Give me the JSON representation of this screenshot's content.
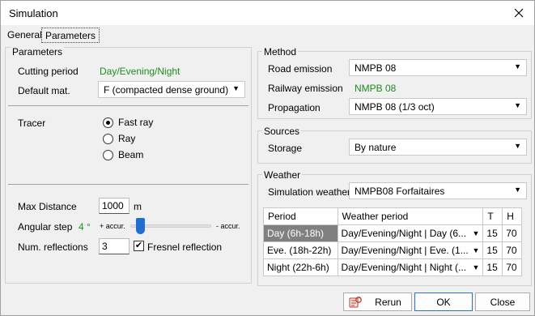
{
  "window": {
    "title": "Simulation"
  },
  "tabs": [
    "General",
    "Parameters"
  ],
  "parameters": {
    "group_title": "Parameters",
    "cutting_period_label": "Cutting period",
    "cutting_period_value": "Day/Evening/Night",
    "default_mat_label": "Default mat.",
    "default_mat_value": "F (compacted dense ground)",
    "tracer_label": "Tracer",
    "tracer_options": [
      "Fast ray",
      "Ray",
      "Beam"
    ],
    "tracer_selected": "Fast ray",
    "max_distance_label": "Max Distance",
    "max_distance_value": "1000",
    "max_distance_unit": "m",
    "angular_step_label": "Angular step",
    "angular_step_value": "4 °",
    "accur_more": "+ accur.",
    "accur_less": "- accur.",
    "angular_step_level": 0.12,
    "num_reflections_label": "Num. reflections",
    "num_reflections_value": "3",
    "fresnel_label": "Fresnel reflection",
    "fresnel_checked": true
  },
  "method": {
    "group_title": "Method",
    "road_label": "Road emission",
    "road_value": "NMPB 08",
    "rail_label": "Railway emission",
    "rail_value": "NMPB 08",
    "prop_label": "Propagation",
    "prop_value": "NMPB 08 (1/3 oct)"
  },
  "sources": {
    "group_title": "Sources",
    "storage_label": "Storage",
    "storage_value": "By nature"
  },
  "weather": {
    "group_title": "Weather",
    "sim_label": "Simulation weather",
    "sim_value": "NMPB08 Forfaitaires",
    "headers": [
      "Period",
      "Weather period",
      "T",
      "H"
    ],
    "rows": [
      {
        "period": "Day (6h-18h)",
        "weather": "Day/Evening/Night  |  Day (6...",
        "t": "15",
        "h": "70"
      },
      {
        "period": "Eve. (18h-22h)",
        "weather": "Day/Evening/Night  |  Eve. (1...",
        "t": "15",
        "h": "70"
      },
      {
        "period": "Night (22h-6h)",
        "weather": "Day/Evening/Night  |  Night (...",
        "t": "15",
        "h": "70"
      }
    ]
  },
  "buttons": {
    "rerun": "Rerun",
    "ok": "OK",
    "close": "Close"
  },
  "icons": {
    "close": "close-icon",
    "rerun": "rerun-icon",
    "dropdown": "chevron-down-icon"
  },
  "colors": {
    "accent_green": "#1e8c1e",
    "slider_thumb": "#1e6fd0",
    "selected_row": "#808080"
  }
}
